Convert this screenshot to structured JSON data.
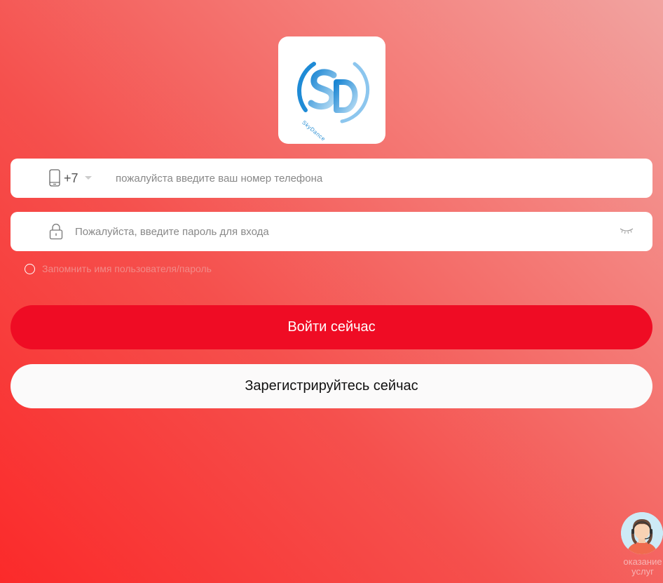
{
  "logo": {
    "name": "SkyDance",
    "letters": "SD"
  },
  "phone": {
    "icon": "phone-icon",
    "country_code": "+7",
    "value": "",
    "placeholder": "пожалуйста введите ваш номер телефона"
  },
  "password": {
    "icon": "lock-icon",
    "value": "",
    "placeholder": "Пожалуйста, введите пароль для входа",
    "toggle_icon": "eye-closed-icon"
  },
  "remember": {
    "label": "Запомнить имя пользователя/пароль",
    "checked": false
  },
  "buttons": {
    "login_label": "Войти сейчас",
    "register_label": "Зарегистрируйтесь сейчас"
  },
  "support": {
    "icon": "customer-service-icon",
    "label_line1": "оказание",
    "label_line2": "услуг"
  },
  "colors": {
    "background_top_right": "#f2a3a0",
    "background_bottom_left": "#fb2a2a",
    "login_button": "#ef0c24",
    "register_button": "#fbfafa",
    "logo_blue": "#2a8fd4"
  }
}
